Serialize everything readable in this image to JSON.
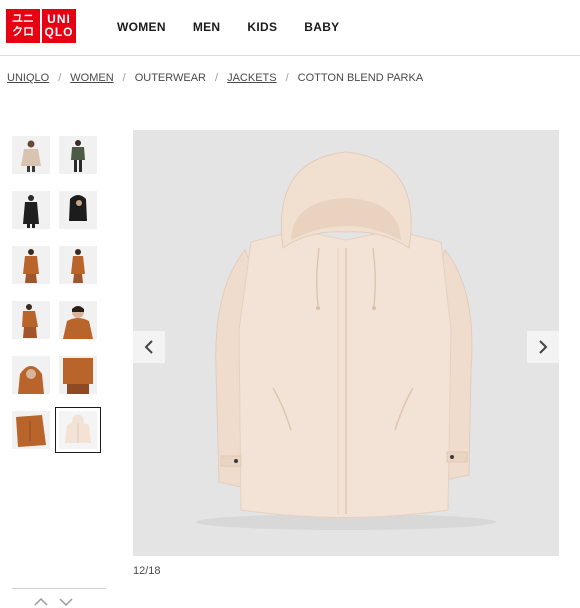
{
  "logo": {
    "kana_top": "ユニ",
    "kana_bottom": "クロ",
    "latin_top": "UNI",
    "latin_bottom": "QLO",
    "color": "#e60012"
  },
  "nav": {
    "items": [
      "WOMEN",
      "MEN",
      "KIDS",
      "BABY"
    ]
  },
  "breadcrumb": {
    "items": [
      "UNIQLO",
      "WOMEN",
      "OUTERWEAR",
      "JACKETS",
      "COTTON BLEND PARKA"
    ],
    "separator": "/"
  },
  "gallery": {
    "thumbnail_icons": [
      "model-beige-parka-thumb",
      "model-green-parka-thumb",
      "model-black-parka-thumb",
      "model-black-parka-hood-thumb",
      "model-brown-parka-thumb",
      "model-brown-parka-back-thumb",
      "model-brown-parka-side-thumb",
      "model-brown-parka-closeup-thumb",
      "model-brown-parka-hood-thumb",
      "model-brown-parka-crop-thumb",
      "brown-parka-detail-thumb",
      "beige-parka-product-thumb"
    ],
    "selected_index": 11,
    "counter": "12/18",
    "main_image_icon": "beige-parka-product-image",
    "prev_icon": "chevron-left-icon",
    "next_icon": "chevron-right-icon",
    "scroll_up_icon": "chevron-up-icon",
    "scroll_down_icon": "chevron-down-icon"
  },
  "colors": {
    "accent": "#e60012",
    "image_background": "#e4e4e4",
    "parka": "#f3e3d6",
    "brown": "#b8642a"
  }
}
